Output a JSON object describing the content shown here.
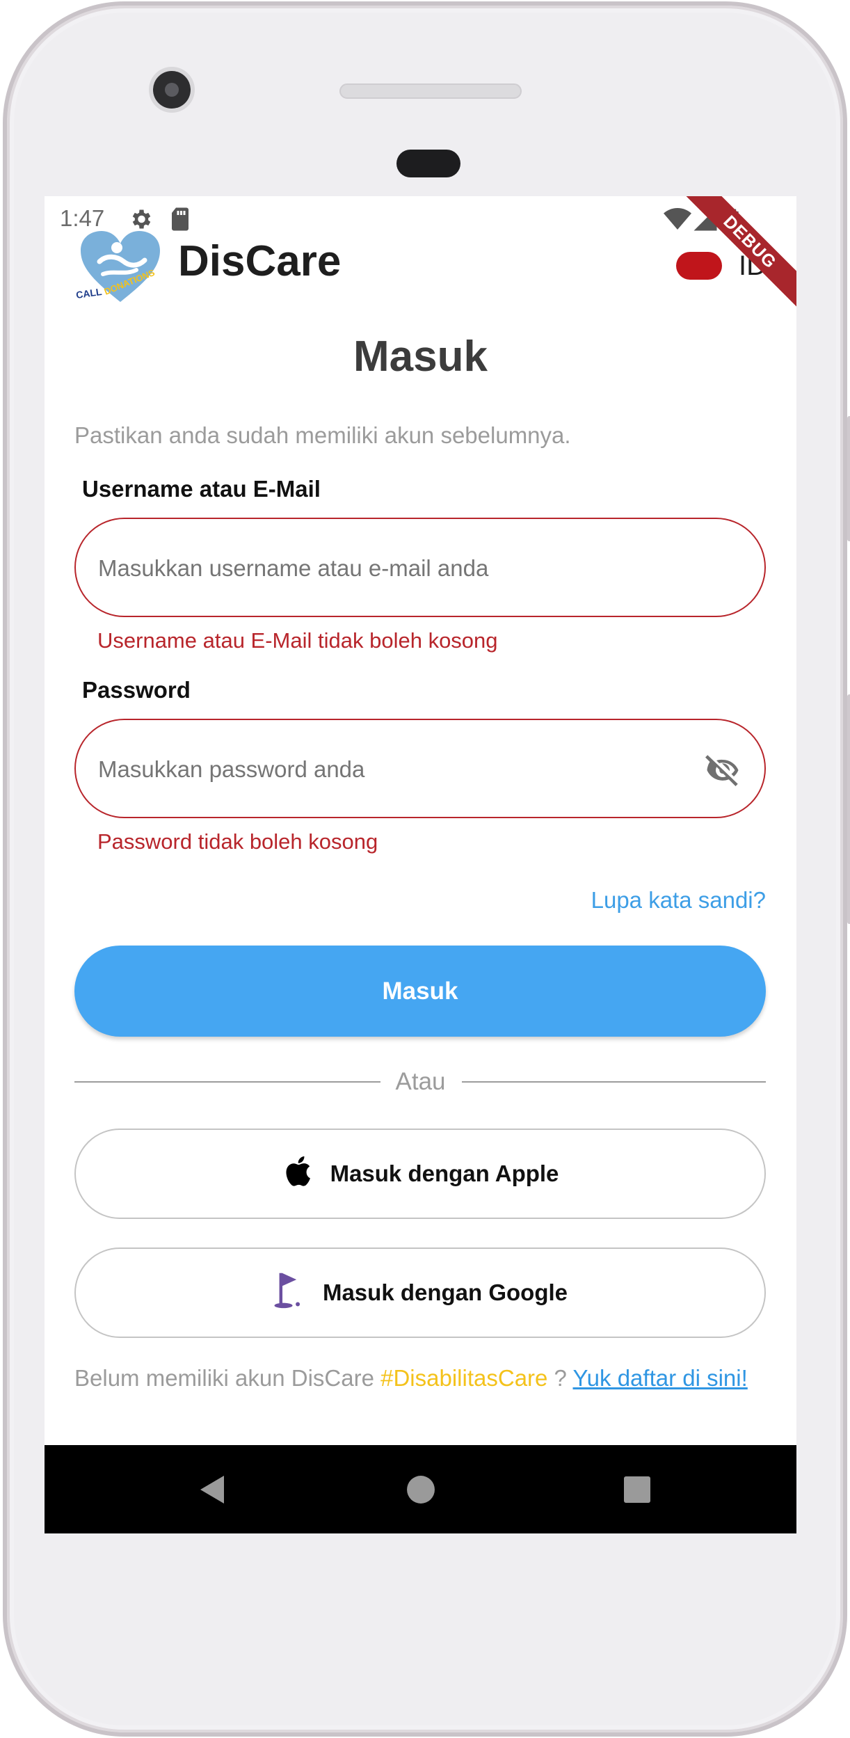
{
  "status_bar": {
    "time": "1:47"
  },
  "app_bar": {
    "brand": "DisCare",
    "logo_text": "CALL for DONATIONS",
    "language": "ID",
    "debug_banner": "DEBUG"
  },
  "login": {
    "title": "Masuk",
    "subtitle": "Pastikan anda sudah memiliki akun sebelumnya.",
    "username": {
      "label": "Username atau E-Mail",
      "placeholder": "Masukkan username atau e-mail anda",
      "value": "",
      "error": "Username atau E-Mail tidak boleh kosong"
    },
    "password": {
      "label": "Password",
      "placeholder": "Masukkan password anda",
      "value": "",
      "error": "Password tidak boleh kosong"
    },
    "forgot_label": "Lupa kata sandi?",
    "submit_label": "Masuk",
    "divider_label": "Atau",
    "apple_label": "Masuk dengan Apple",
    "google_label": "Masuk dengan Google",
    "footer": {
      "text": "Belum memiliki akun DisCare ",
      "hashtag": "#DisabilitasCare",
      "question": " ? ",
      "link": "Yuk daftar di sini!"
    }
  },
  "colors": {
    "accent": "#45a6f2",
    "error": "#b8252b",
    "hashtag": "#f4c21b",
    "link": "#2f96e3"
  }
}
